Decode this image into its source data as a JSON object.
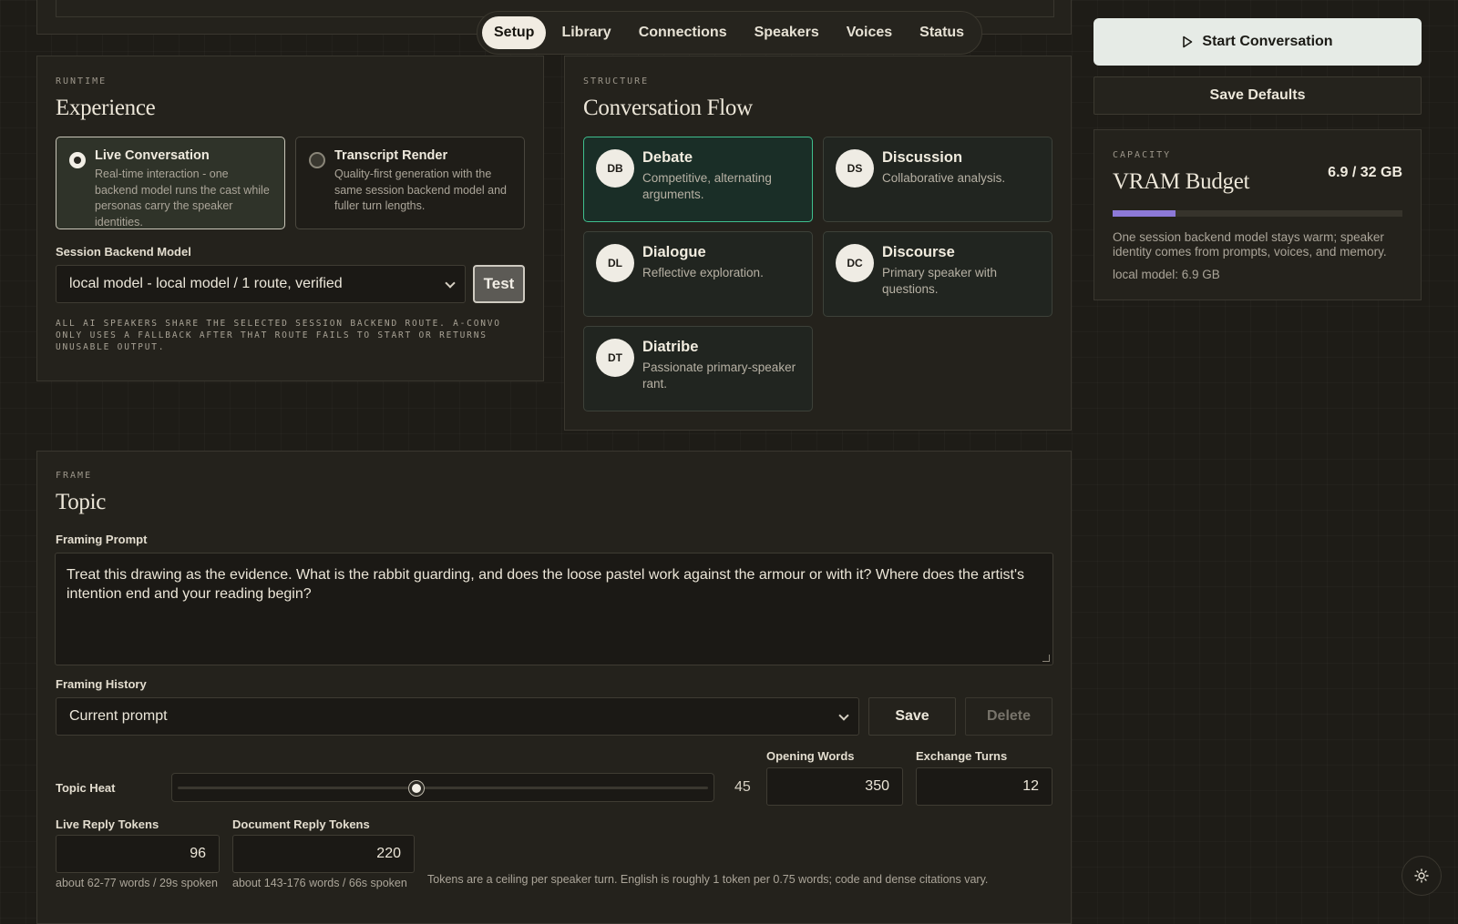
{
  "nav": {
    "tabs": [
      "Setup",
      "Library",
      "Connections",
      "Speakers",
      "Voices",
      "Status"
    ],
    "active_index": 0
  },
  "actions": {
    "start_label": "Start Conversation",
    "save_defaults_label": "Save Defaults"
  },
  "experience": {
    "kicker": "RUNTIME",
    "title": "Experience",
    "modes": [
      {
        "title": "Live Conversation",
        "desc": "Real-time interaction - one backend model runs the cast while personas carry the speaker identities.",
        "selected": true
      },
      {
        "title": "Transcript Render",
        "desc": "Quality-first generation with the same session backend model and fuller turn lengths.",
        "selected": false
      }
    ],
    "backend_label": "Session Backend Model",
    "backend_value": "local model - local model / 1 route, verified",
    "test_label": "Test",
    "note": "ALL AI SPEAKERS SHARE THE SELECTED SESSION BACKEND ROUTE. A-CONVO ONLY USES A FALLBACK AFTER THAT ROUTE FAILS TO START OR RETURNS UNUSABLE OUTPUT."
  },
  "flow": {
    "kicker": "STRUCTURE",
    "title": "Conversation Flow",
    "options": [
      {
        "badge": "DB",
        "title": "Debate",
        "desc": "Competitive, alternating arguments.",
        "selected": true
      },
      {
        "badge": "DS",
        "title": "Discussion",
        "desc": "Collaborative analysis.",
        "selected": false
      },
      {
        "badge": "DL",
        "title": "Dialogue",
        "desc": "Reflective exploration.",
        "selected": false
      },
      {
        "badge": "DC",
        "title": "Discourse",
        "desc": "Primary speaker with questions.",
        "selected": false
      },
      {
        "badge": "DT",
        "title": "Diatribe",
        "desc": "Passionate primary-speaker rant.",
        "selected": false
      }
    ]
  },
  "capacity": {
    "kicker": "CAPACITY",
    "title": "VRAM Budget",
    "value": "6.9 / 32 GB",
    "used_fraction": 0.216,
    "bar_color": "#8d79d8",
    "desc": "One session backend model stays warm; speaker identity comes from prompts, voices, and memory.",
    "detail": "local model: 6.9 GB"
  },
  "topic": {
    "kicker": "FRAME",
    "title": "Topic",
    "prompt_label": "Framing Prompt",
    "prompt_value": "Treat this drawing as the evidence. What is the rabbit guarding, and does the loose pastel work against the armour or with it? Where does the artist's intention end and your reading begin?",
    "history_label": "Framing History",
    "history_value": "Current prompt",
    "save_label": "Save",
    "delete_label": "Delete",
    "heat_label": "Topic Heat",
    "heat_value": "45",
    "heat_fraction": 0.45,
    "opening_label": "Opening Words",
    "opening_value": "350",
    "turns_label": "Exchange Turns",
    "turns_value": "12",
    "live_tokens_label": "Live Reply Tokens",
    "live_tokens_value": "96",
    "live_tokens_note": "about 62-77 words / 29s spoken",
    "doc_tokens_label": "Document Reply Tokens",
    "doc_tokens_value": "220",
    "doc_tokens_note": "about 143-176 words / 66s spoken",
    "tokens_note": "Tokens are a ceiling per speaker turn. English is roughly 1 token per 0.75 words; code and dense citations vary."
  },
  "icons": {
    "start": "play-icon",
    "theme": "sun-icon"
  }
}
